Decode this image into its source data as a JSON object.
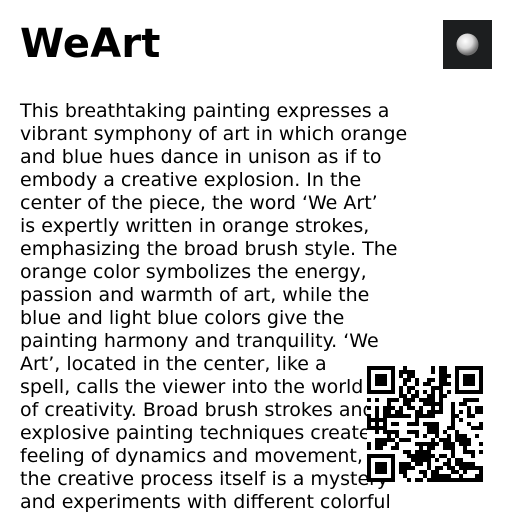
{
  "app": {
    "title": "WeArt"
  },
  "artwork": {
    "thumbnail_icon": "dark-artwork-thumbnail",
    "description": "This breathtaking painting expresses a\nvibrant symphony of art in which orange\nand blue hues dance in unison as if to\nembody a creative explosion. In the\ncenter of the piece, the word ‘We Art’\nis expertly written in orange strokes,\nemphasizing the broad brush style. The\norange color symbolizes the energy,\npassion and warmth of art, while the\nblue and light blue colors give the\npainting harmony and tranquility. ‘We\nArt’, located in the center, like a\nspell, calls the viewer into the world\nof creativity. Broad brush strokes and\nexplosive painting techniques create a\nfeeling of dynamics and movement, as if\nthe creative process itself is a mystery\nand experiments with different colorful"
  },
  "qr": {
    "icon": "qr-code-icon"
  },
  "colors": {
    "background": "#ffffff",
    "text": "#000000",
    "thumbnail_bg": "#1c1e1f"
  }
}
